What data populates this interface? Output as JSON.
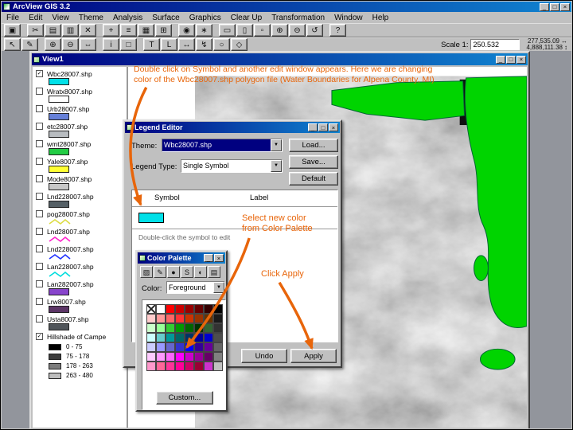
{
  "window": {
    "title": "ArcView GIS 3.2",
    "controls": {
      "minimize": "_",
      "maximize": "□",
      "close": "×"
    }
  },
  "menu": {
    "items": [
      "File",
      "Edit",
      "View",
      "Theme",
      "Analysis",
      "Surface",
      "Graphics",
      "Clear Up",
      "Transformation",
      "Window",
      "Help"
    ]
  },
  "toolbar_top": {
    "buttons": [
      {
        "name": "save-project-button",
        "glyph": "▣"
      },
      {
        "name": "cut-button",
        "glyph": "✂",
        "gap": true
      },
      {
        "name": "copy-button",
        "glyph": "▤"
      },
      {
        "name": "paste-button",
        "glyph": "▥"
      },
      {
        "name": "delete-button",
        "glyph": "✕"
      },
      {
        "name": "add-theme-button",
        "glyph": "+",
        "gap": true
      },
      {
        "name": "theme-properties-button",
        "glyph": "≡"
      },
      {
        "name": "edit-legend-button",
        "glyph": "▦"
      },
      {
        "name": "open-theme-table-button",
        "glyph": "⊞"
      },
      {
        "name": "find-button",
        "glyph": "◉",
        "gap": true
      },
      {
        "name": "query-builder-button",
        "glyph": "∗"
      },
      {
        "name": "zoom-full-extent-button",
        "glyph": "▭",
        "gap": true
      },
      {
        "name": "zoom-active-theme-button",
        "glyph": "▯"
      },
      {
        "name": "zoom-selected-button",
        "glyph": "▫"
      },
      {
        "name": "zoom-in-button",
        "glyph": "⊕"
      },
      {
        "name": "zoom-out-button",
        "glyph": "⊖"
      },
      {
        "name": "zoom-previous-button",
        "glyph": "↺"
      },
      {
        "name": "help-button",
        "glyph": "?",
        "gap": true
      }
    ]
  },
  "toolbar_bottom": {
    "buttons": [
      {
        "name": "pointer-tool",
        "glyph": "↖"
      },
      {
        "name": "vertex-edit-tool",
        "glyph": "✎"
      },
      {
        "name": "zoom-in-tool",
        "glyph": "⊕",
        "gap": true
      },
      {
        "name": "zoom-out-tool",
        "glyph": "⊖"
      },
      {
        "name": "pan-tool",
        "glyph": "⇔"
      },
      {
        "name": "identify-tool",
        "glyph": "i",
        "gap": true
      },
      {
        "name": "select-feature-tool",
        "glyph": "□"
      },
      {
        "name": "text-tool",
        "glyph": "T",
        "gap": true
      },
      {
        "name": "label-tool",
        "glyph": "L"
      },
      {
        "name": "measure-tool",
        "glyph": "↔"
      },
      {
        "name": "hot-link-tool",
        "glyph": "↯"
      },
      {
        "name": "draw-tool",
        "glyph": "○"
      },
      {
        "name": "area-of-interest-tool",
        "glyph": "◇"
      }
    ],
    "scale_label": "Scale 1:",
    "scale_value": "250.532",
    "coord_x": "277,535.09",
    "coord_y": "4,888,111.38",
    "coord_x_icon": "↔",
    "coord_y_icon": "↕"
  },
  "view_window": {
    "title": "View1",
    "legend": {
      "themes": [
        {
          "label": "Wbc28007.shp",
          "checked": true,
          "symbol": "fill",
          "color": "#00e0e8"
        },
        {
          "label": "Wratx8007.shp",
          "checked": false,
          "symbol": "fill",
          "color": "#ffffff"
        },
        {
          "label": "Urb28007.shp",
          "checked": false,
          "symbol": "fill",
          "color": "#6680d8"
        },
        {
          "label": "etc28007.shp",
          "checked": false,
          "symbol": "fill",
          "color": "#b8bcc0"
        },
        {
          "label": "wmt28007.shp",
          "checked": false,
          "symbol": "fill",
          "color": "#22cc44"
        },
        {
          "label": "Yale8007.shp",
          "checked": false,
          "symbol": "fill",
          "color": "#ffff33"
        },
        {
          "label": "Mode8007.shp",
          "checked": false,
          "symbol": "fill",
          "color": "#c8c8c8"
        },
        {
          "label": "Lnd228007.shp",
          "checked": false,
          "symbol": "fill",
          "color": "#556066"
        },
        {
          "label": "pog28007.shp",
          "checked": false,
          "symbol": "line",
          "color": "#dddd44"
        },
        {
          "label": "Lnd28007.shp",
          "checked": false,
          "symbol": "line",
          "color": "#ff22cc"
        },
        {
          "label": "Lnd228007.shp",
          "checked": false,
          "symbol": "line",
          "color": "#2233ff"
        },
        {
          "label": "Lan228007.shp",
          "checked": false,
          "symbol": "line",
          "color": "#00dddd"
        },
        {
          "label": "Lan282007.shp",
          "checked": false,
          "symbol": "fill",
          "color": "#8844cc"
        },
        {
          "label": "Lrw8007.shp",
          "checked": false,
          "symbol": "fill",
          "color": "#5c3566"
        },
        {
          "label": "Usta8007.shp",
          "checked": false,
          "symbol": "fill",
          "color": "#50555a"
        }
      ],
      "hillshade": {
        "label": "Hillshade of Campe",
        "checked": true,
        "classes": [
          {
            "range": "0 - 75",
            "color": "#000000"
          },
          {
            "range": "75 - 178",
            "color": "#3c3c3c"
          },
          {
            "range": "178 - 263",
            "color": "#7d7d7d"
          },
          {
            "range": "263 - 480",
            "color": "#bdbdbd"
          }
        ]
      }
    }
  },
  "legend_editor": {
    "title": "Legend Editor",
    "theme_label": "Theme:",
    "theme_value": "Wbc28007.shp",
    "load_button": "Load...",
    "save_button": "Save...",
    "default_button": "Default",
    "legend_type_label": "Legend Type:",
    "legend_type_value": "Single Symbol",
    "symbol_header": "Symbol",
    "label_header": "Label",
    "symbol_color": "#00e0e8",
    "hint": "Double-click the symbol to edit",
    "undo_button": "Undo",
    "apply_button": "Apply"
  },
  "color_palette": {
    "title": "Color Palette",
    "tools": [
      {
        "name": "fill-palette-tool",
        "glyph": "▨"
      },
      {
        "name": "pen-palette-tool",
        "glyph": "✎"
      },
      {
        "name": "marker-palette-tool",
        "glyph": "●"
      },
      {
        "name": "font-palette-tool",
        "glyph": "S"
      },
      {
        "name": "color-palette-tool",
        "glyph": "◐"
      },
      {
        "name": "palette-manager-tool",
        "glyph": "▤"
      }
    ],
    "color_label": "Color:",
    "color_value": "Foreground",
    "custom_button": "Custom...",
    "swatches": [
      "none",
      "#ffffff",
      "#ff0000",
      "#cc0000",
      "#990000",
      "#660000",
      "#330000",
      "#000000",
      "#ffcccc",
      "#ff9999",
      "#ff6666",
      "#ff3333",
      "#cc3300",
      "#993300",
      "#663300",
      "#1a1a1a",
      "#ccffcc",
      "#99ff99",
      "#33cc33",
      "#009900",
      "#006600",
      "#003300",
      "#336633",
      "#333333",
      "#ccffff",
      "#66cccc",
      "#009999",
      "#006666",
      "#003366",
      "#000099",
      "#0000cc",
      "#4d4d4d",
      "#ccccff",
      "#9999ff",
      "#6666cc",
      "#3333cc",
      "#0000ff",
      "#330099",
      "#660099",
      "#666666",
      "#ffccff",
      "#ff99ff",
      "#ff66ff",
      "#ff00ff",
      "#cc00cc",
      "#990099",
      "#660066",
      "#808080",
      "#ff99cc",
      "#ff6699",
      "#ff3399",
      "#ff0099",
      "#cc0066",
      "#990033",
      "#cc33cc",
      "#c0c0c0"
    ]
  },
  "annotations": {
    "color": "#e8650a",
    "note1_line1": "Double click on Symbol and another edit window appears.  Here we are changing",
    "note1_line2": "color of the Wbc28007.shp polygon file (Water Boundaries for Alpena County, MI)",
    "note2_line1": "Select new color",
    "note2_line2": "from Color Palette",
    "note3": "Click Apply"
  },
  "map": {
    "county_color": "#00d400"
  }
}
